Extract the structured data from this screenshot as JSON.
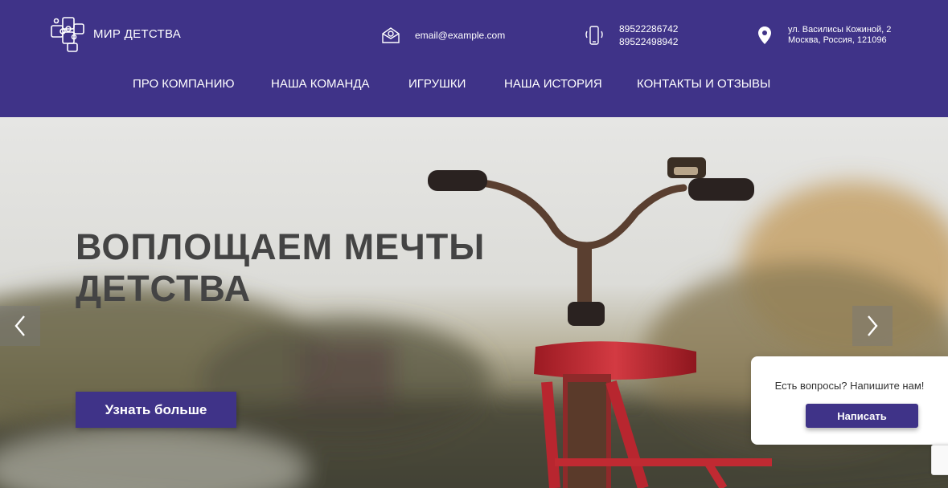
{
  "brand": {
    "name": "МИР ДЕТСТВА",
    "logo_icon": "puzzle-icon"
  },
  "contacts": {
    "email": "email@example.com",
    "phones": [
      "89522286742",
      "89522498942"
    ],
    "address": [
      "ул. Василисы Кожиной, 2",
      "Москва, Россия, 121096"
    ]
  },
  "nav": {
    "items": [
      {
        "label": "ПРО КОМПАНИЮ"
      },
      {
        "label": "НАША КОМАНДА"
      },
      {
        "label": "ИГРУШКИ"
      },
      {
        "label": "НАША ИСТОРИЯ"
      },
      {
        "label": "КОНТАКТЫ И ОТЗЫВЫ"
      }
    ]
  },
  "hero": {
    "title": "ВОПЛОЩАЕМ МЕЧТЫ ДЕТСТВА",
    "cta_label": "Узнать больше"
  },
  "chat": {
    "question": "Есть вопросы? Напишите нам!",
    "button_label": "Написать"
  },
  "colors": {
    "primary": "#3f3388",
    "white": "#ffffff",
    "hero_title": "#444444"
  }
}
